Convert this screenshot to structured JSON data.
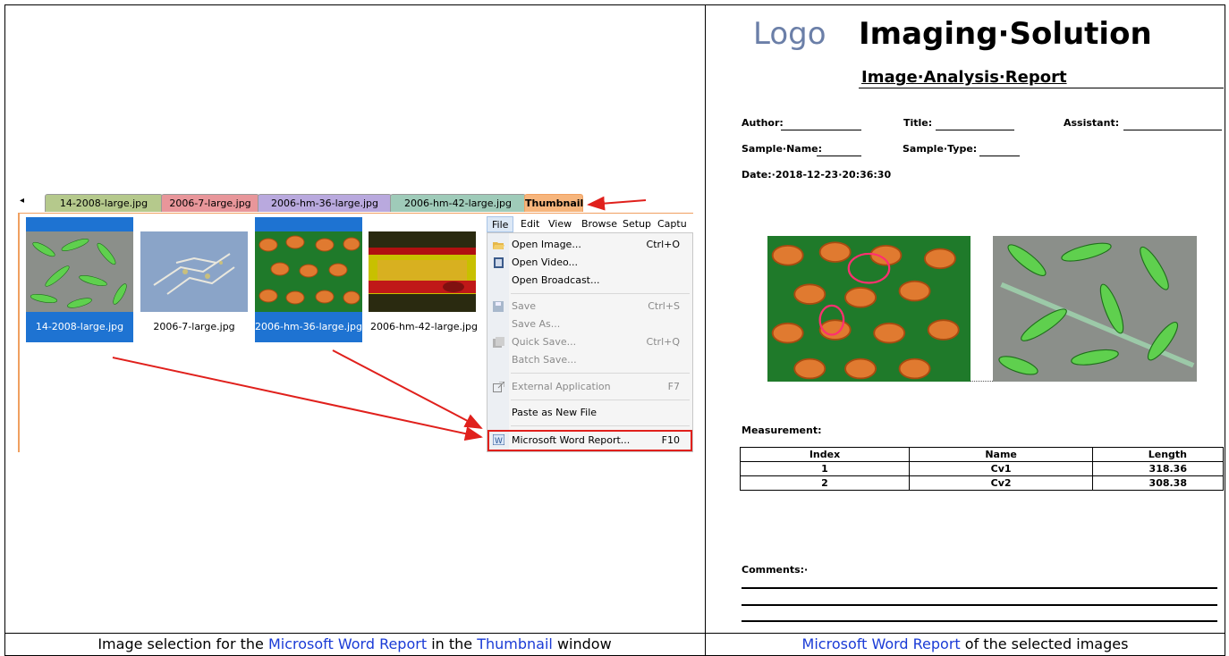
{
  "tabs": [
    "14-2008-large.jpg",
    "2006-7-large.jpg",
    "2006-hm-36-large.jpg",
    "2006-hm-42-large.jpg",
    "Thumbnail"
  ],
  "thumbnails": [
    {
      "label": "14-2008-large.jpg",
      "selected": true
    },
    {
      "label": "2006-7-large.jpg",
      "selected": false
    },
    {
      "label": "2006-hm-36-large.jpg",
      "selected": true
    },
    {
      "label": "2006-hm-42-large.jpg",
      "selected": false
    }
  ],
  "menubar": [
    "File",
    "Edit",
    "View",
    "Browse",
    "Setup",
    "Captu"
  ],
  "menu_items": [
    {
      "label": "Open Image...",
      "shortcut": "Ctrl+O",
      "icon": "folder-open-icon"
    },
    {
      "label": "Open Video...",
      "shortcut": "",
      "icon": "film-icon"
    },
    {
      "label": "Open Broadcast...",
      "shortcut": "",
      "icon": ""
    },
    {
      "label": "Save",
      "shortcut": "Ctrl+S",
      "icon": "save-icon"
    },
    {
      "label": "Save As...",
      "shortcut": "",
      "icon": ""
    },
    {
      "label": "Quick Save...",
      "shortcut": "Ctrl+Q",
      "icon": "quick-save-icon"
    },
    {
      "label": "Batch Save...",
      "shortcut": "",
      "icon": ""
    },
    {
      "label": "External Application",
      "shortcut": "F7",
      "icon": "external-app-icon"
    },
    {
      "label": "Paste as New File",
      "shortcut": "",
      "icon": ""
    },
    {
      "label": "Microsoft Word Report...",
      "shortcut": "F10",
      "icon": "word-icon"
    }
  ],
  "caption_left": {
    "pre": "Image selection for the ",
    "link1": "Microsoft Word Report",
    "mid": " in the ",
    "link2": "Thumbnail",
    "post": " window"
  },
  "caption_right": {
    "link": "Microsoft Word Report",
    "post": " of the selected images"
  },
  "report": {
    "logo": "Logo",
    "title": "Imaging·Solution",
    "subtitle": "Image·Analysis·Report",
    "author_label": "Author:",
    "title_label": "Title:",
    "assistant_label": "Assistant:",
    "sample_name_label": "Sample·Name:",
    "sample_type_label": "Sample·Type:",
    "date_line": "Date:·2018-12-23·20:36:30",
    "measurement_label": "Measurement:",
    "comments_label": "Comments:·",
    "table_headers": [
      "Index",
      "Name",
      "Length"
    ],
    "table_rows": [
      [
        "1",
        "Cv1",
        "318.36"
      ],
      [
        "2",
        "Cv2",
        "308.38"
      ]
    ]
  },
  "colors": {
    "tab1": "#b5c98c",
    "tab2": "#e8969a",
    "tab3": "#b9a9de",
    "tab4": "#9fcbb9",
    "tab5": "#f7b57c",
    "selection": "#1e73d2",
    "link": "#1a3bd6",
    "arrow": "#e0201c"
  }
}
